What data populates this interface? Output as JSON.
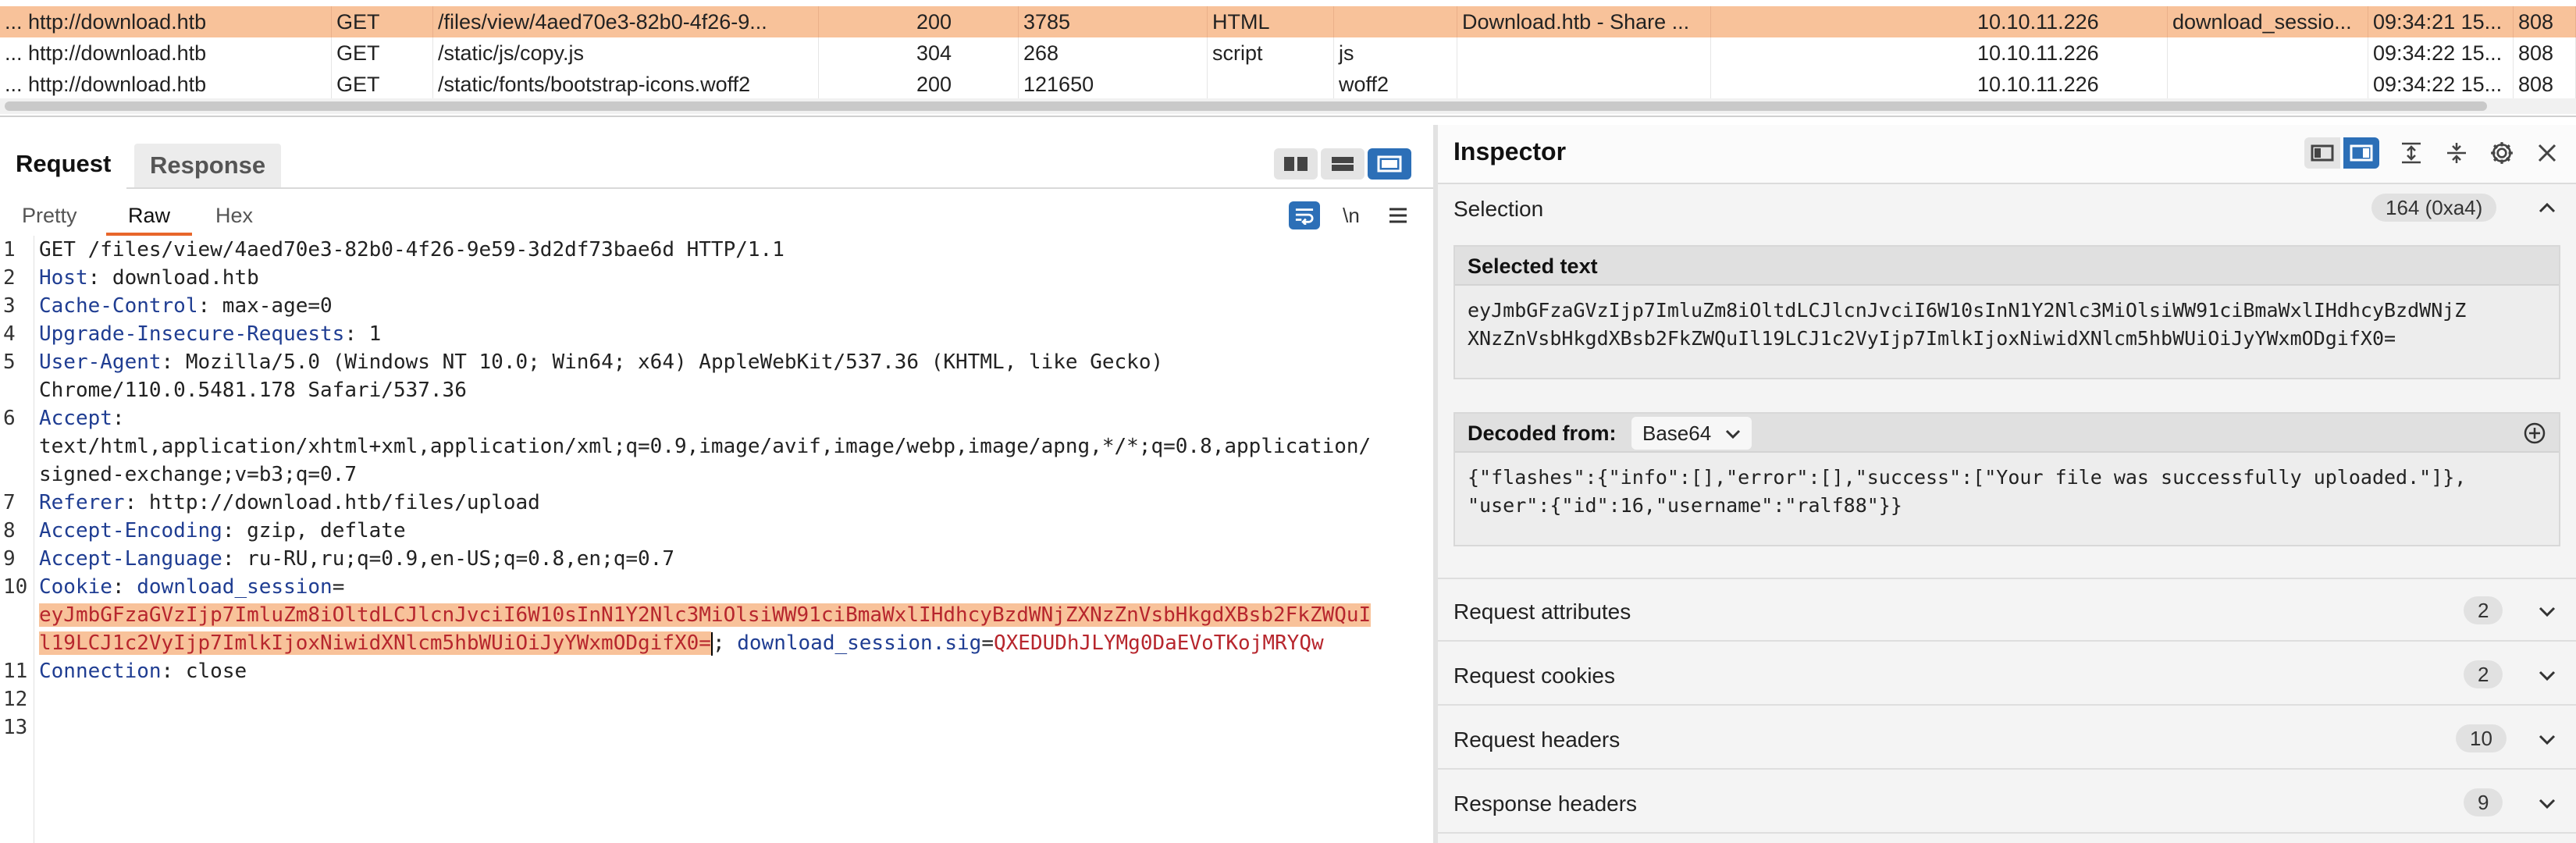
{
  "history": {
    "rows": [
      {
        "host": "... http://download.htb",
        "method": "GET",
        "url": "/files/view/4aed70e3-82b0-4f26-9...",
        "status": "200",
        "length": "3785",
        "mime": "HTML",
        "ext": "",
        "title": "Download.htb - Share ...",
        "ip": "10.10.11.226",
        "cookies": "download_sessio...",
        "time": "09:34:21 15...",
        "port": "808",
        "selected": true
      },
      {
        "host": "... http://download.htb",
        "method": "GET",
        "url": "/static/js/copy.js",
        "status": "304",
        "length": "268",
        "mime": "script",
        "ext": "js",
        "title": "",
        "ip": "10.10.11.226",
        "cookies": "",
        "time": "09:34:22 15...",
        "port": "808",
        "selected": false
      },
      {
        "host": "... http://download.htb",
        "method": "GET",
        "url": "/static/fonts/bootstrap-icons.woff2",
        "status": "200",
        "length": "121650",
        "mime": "",
        "ext": "woff2",
        "title": "",
        "ip": "10.10.11.226",
        "cookies": "",
        "time": "09:34:22 15...",
        "port": "808",
        "selected": false
      }
    ]
  },
  "request_pane": {
    "tabs": [
      "Request",
      "Response"
    ],
    "active_tab": "Request",
    "subtabs": [
      "Pretty",
      "Raw",
      "Hex"
    ],
    "active_subtab": "Raw",
    "newline_label": "\\n",
    "lines": [
      {
        "n": "1",
        "parts": [
          {
            "t": "GET /files/view/4aed70e3-82b0-4f26-9e59-3d2df73bae6d HTTP/1.1",
            "c": ""
          }
        ]
      },
      {
        "n": "2",
        "parts": [
          {
            "t": "Host",
            "c": "hk"
          },
          {
            "t": ": download.htb",
            "c": ""
          }
        ]
      },
      {
        "n": "3",
        "parts": [
          {
            "t": "Cache-Control",
            "c": "hk"
          },
          {
            "t": ": max-age=0",
            "c": ""
          }
        ]
      },
      {
        "n": "4",
        "parts": [
          {
            "t": "Upgrade-Insecure-Requests",
            "c": "hk"
          },
          {
            "t": ": 1",
            "c": ""
          }
        ]
      },
      {
        "n": "5",
        "parts": [
          {
            "t": "User-Agent",
            "c": "hk"
          },
          {
            "t": ": Mozilla/5.0 (Windows NT 10.0; Win64; x64) AppleWebKit/537.36 (KHTML, like Gecko)",
            "c": ""
          }
        ]
      },
      {
        "n": "",
        "parts": [
          {
            "t": "Chrome/110.0.5481.178 Safari/537.36",
            "c": ""
          }
        ]
      },
      {
        "n": "6",
        "parts": [
          {
            "t": "Accept",
            "c": "hk"
          },
          {
            "t": ":",
            "c": ""
          }
        ]
      },
      {
        "n": "",
        "parts": [
          {
            "t": "text/html,application/xhtml+xml,application/xml;q=0.9,image/avif,image/webp,image/apng,*/*;q=0.8,application/",
            "c": ""
          }
        ]
      },
      {
        "n": "",
        "parts": [
          {
            "t": "signed-exchange;v=b3;q=0.7",
            "c": ""
          }
        ]
      },
      {
        "n": "7",
        "parts": [
          {
            "t": "Referer",
            "c": "hk"
          },
          {
            "t": ": http://download.htb/files/upload",
            "c": ""
          }
        ]
      },
      {
        "n": "8",
        "parts": [
          {
            "t": "Accept-Encoding",
            "c": "hk"
          },
          {
            "t": ": gzip, deflate",
            "c": ""
          }
        ]
      },
      {
        "n": "9",
        "parts": [
          {
            "t": "Accept-Language",
            "c": "hk"
          },
          {
            "t": ": ru-RU,ru;q=0.9,en-US;q=0.8,en;q=0.7",
            "c": ""
          }
        ]
      },
      {
        "n": "10",
        "parts": [
          {
            "t": "Cookie",
            "c": "hk"
          },
          {
            "t": ": ",
            "c": ""
          },
          {
            "t": "download_session",
            "c": "hk"
          },
          {
            "t": "=",
            "c": ""
          }
        ]
      },
      {
        "n": "",
        "parts": [
          {
            "t": "eyJmbGFzaGVzIjp7ImluZm8iOltdLCJlcnJvciI6W10sInN1Y2Nlc3MiOlsiWW91ciBmaWxlIHdhcyBzdWNjZXNzZnVsbHkgdXBsb2FkZWQuI",
            "c": "hl"
          }
        ]
      },
      {
        "n": "",
        "parts": [
          {
            "t": "l19LCJ1c2VyIjp7ImlkIjoxNiwidXNlcm5hbWUiOiJyYWxmODgifX0=",
            "c": "hl"
          },
          {
            "t": "",
            "c": "caret"
          },
          {
            "t": "; ",
            "c": ""
          },
          {
            "t": "download_session.sig",
            "c": "hk"
          },
          {
            "t": "=",
            "c": ""
          },
          {
            "t": "QXEDUDhJLYMg0DaEVoTKojMRYQw",
            "c": "cv"
          }
        ]
      },
      {
        "n": "11",
        "parts": [
          {
            "t": "Connection",
            "c": "hk"
          },
          {
            "t": ": close",
            "c": ""
          }
        ]
      },
      {
        "n": "12",
        "parts": []
      },
      {
        "n": "13",
        "parts": []
      }
    ]
  },
  "inspector": {
    "title": "Inspector",
    "selection_label": "Selection",
    "selection_count": "164 (0xa4)",
    "selected_text_title": "Selected text",
    "selected_text": "eyJmbGFzaGVzIjp7ImluZm8iOltdLCJlcnJvciI6W10sInN1Y2Nlc3MiOlsiWW91ciBmaWxlIHdhcyBzdWNjZ\nXNzZnVsbHkgdXBsb2FkZWQuIl19LCJ1c2VyIjp7ImlkIjoxNiwidXNlcm5hbWUiOiJyYWxmODgifX0=",
    "decoded_from_label": "Decoded from:",
    "decoded_from_value": "Base64",
    "decoded_text": "{\"flashes\":{\"info\":[],\"error\":[],\"success\":[\"Your file was successfully uploaded.\"]},\n\"user\":{\"id\":16,\"username\":\"ralf88\"}}",
    "sections": [
      {
        "label": "Request attributes",
        "count": "2"
      },
      {
        "label": "Request cookies",
        "count": "2"
      },
      {
        "label": "Request headers",
        "count": "10"
      },
      {
        "label": "Response headers",
        "count": "9"
      }
    ]
  },
  "colors": {
    "selection": "#f8c29a",
    "header_key": "#1f3d92",
    "cookie_value": "#b7262d",
    "accent_blue": "#2c6fb7",
    "tab_underline": "#e8662b"
  }
}
